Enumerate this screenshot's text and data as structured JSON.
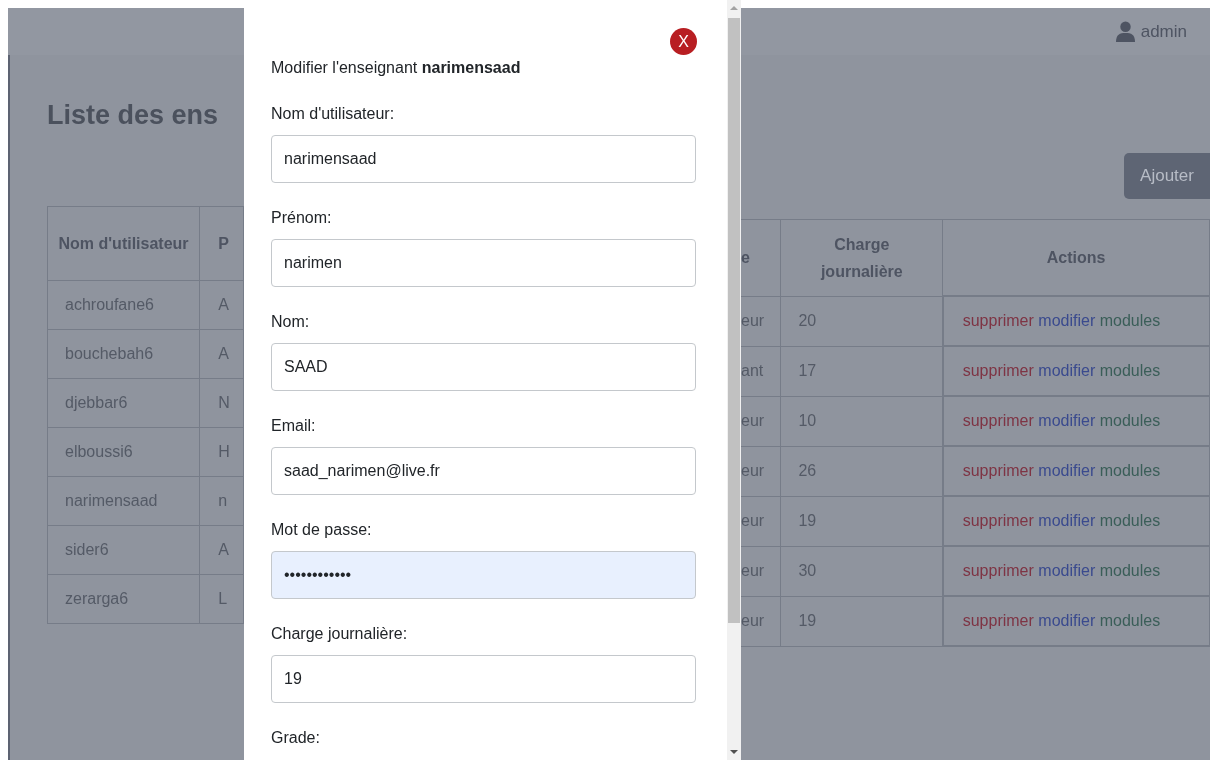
{
  "topbar": {
    "user": "admin"
  },
  "page": {
    "title": "Liste des ens",
    "add_button": "Ajouter"
  },
  "table": {
    "left_columns": [
      "Nom d'utilisateur",
      "P"
    ],
    "right_columns": [
      "e",
      "Charge journalière",
      "Actions"
    ],
    "rows": [
      {
        "username": "achroufane6",
        "column_2": "A",
        "column_3": "eur",
        "charge": "20",
        "actions": [
          {
            "label": "supprimer",
            "kind": "delete"
          },
          {
            "label": "modifier",
            "kind": "edit"
          },
          {
            "label": "modules",
            "kind": "modules"
          }
        ]
      },
      {
        "username": "bouchebah6",
        "column_2": "A",
        "column_3": "ant",
        "charge": "17",
        "actions": [
          {
            "label": "supprimer",
            "kind": "delete"
          },
          {
            "label": "modifier",
            "kind": "edit"
          },
          {
            "label": "modules",
            "kind": "modules"
          }
        ]
      },
      {
        "username": "djebbar6",
        "column_2": "N",
        "column_3": "eur",
        "charge": "10",
        "actions": [
          {
            "label": "supprimer",
            "kind": "delete"
          },
          {
            "label": "modifier",
            "kind": "edit"
          },
          {
            "label": "modules",
            "kind": "modules"
          }
        ]
      },
      {
        "username": "elboussi6",
        "column_2": "H",
        "column_3": "eur",
        "charge": "26",
        "actions": [
          {
            "label": "supprimer",
            "kind": "delete"
          },
          {
            "label": "modifier",
            "kind": "edit"
          },
          {
            "label": "modules",
            "kind": "modules"
          }
        ]
      },
      {
        "username": "narimensaad",
        "column_2": "n",
        "column_3": "eur",
        "charge": "19",
        "actions": [
          {
            "label": "supprimer",
            "kind": "delete"
          },
          {
            "label": "modifier",
            "kind": "edit"
          },
          {
            "label": "modules",
            "kind": "modules"
          }
        ]
      },
      {
        "username": "sider6",
        "column_2": "A",
        "column_3": "eur",
        "charge": "30",
        "actions": [
          {
            "label": "supprimer",
            "kind": "delete"
          },
          {
            "label": "modifier",
            "kind": "edit"
          },
          {
            "label": "modules",
            "kind": "modules"
          }
        ]
      },
      {
        "username": "zerarga6",
        "column_2": "L",
        "column_3": "eur",
        "charge": "19",
        "actions": [
          {
            "label": "supprimer",
            "kind": "delete"
          },
          {
            "label": "modifier",
            "kind": "edit"
          },
          {
            "label": "modules",
            "kind": "modules"
          }
        ]
      }
    ]
  },
  "modal": {
    "close": "X",
    "title": "Modifier l'enseignant **narimensaad**",
    "fields": [
      {
        "label": "Nom d'utilisateur:",
        "value": "narimensaad",
        "autofilled": false
      },
      {
        "label": "Prénom:",
        "value": "narimen",
        "autofilled": false
      },
      {
        "label": "Nom:",
        "value": "SAAD",
        "autofilled": false
      },
      {
        "label": "Email:",
        "value": "saad_narimen@live.fr",
        "autofilled": false
      },
      {
        "label": "Mot de passe:",
        "value": "••••••••••••",
        "autofilled": true
      },
      {
        "label": "Charge journalière:",
        "value": "19",
        "autofilled": false
      },
      {
        "label": "Grade:"
      }
    ]
  }
}
